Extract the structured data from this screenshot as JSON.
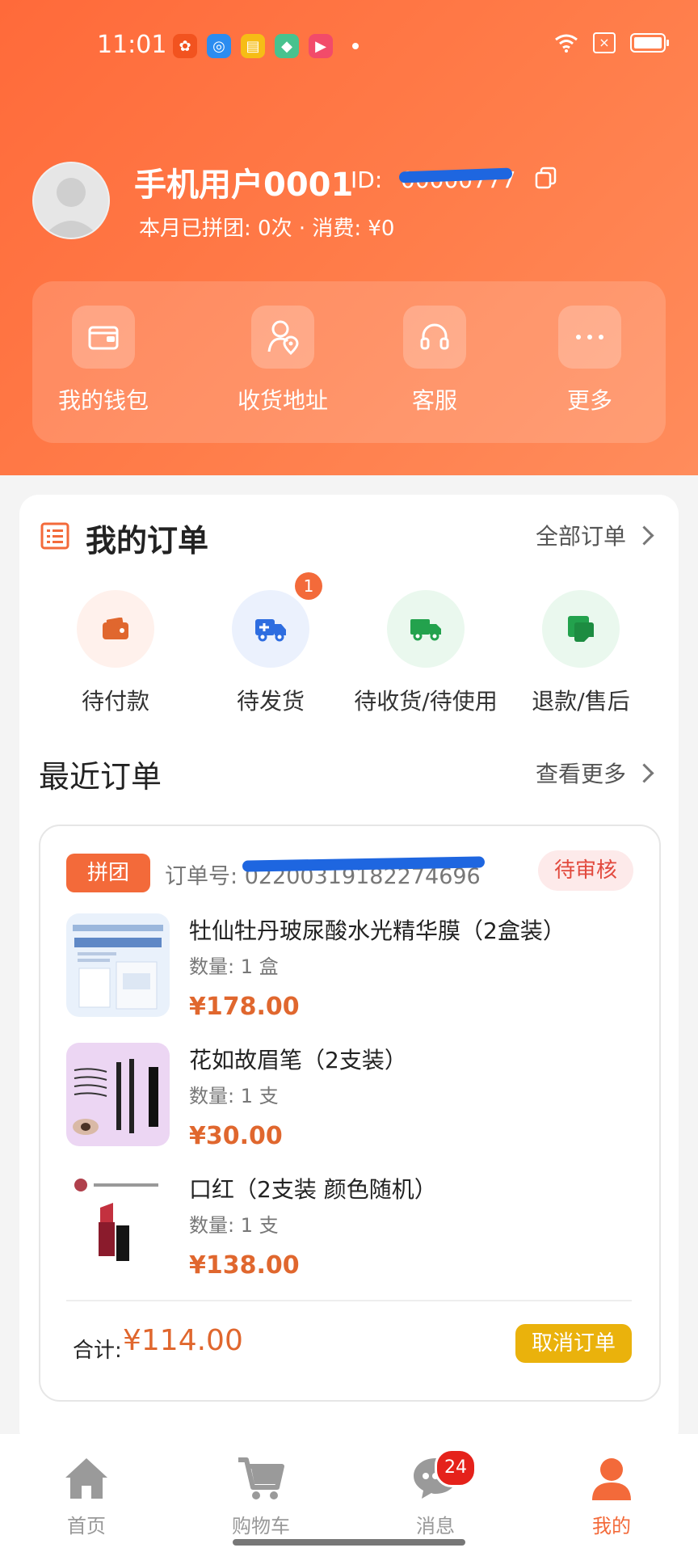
{
  "status_bar": {
    "time": "11:01"
  },
  "profile": {
    "name": "手机用户0001",
    "id_label": "ID:",
    "id_value": "00000777",
    "stats": "本月已拼团: 0次 · 消费: ¥0"
  },
  "quick_actions": [
    {
      "label": "我的钱包",
      "icon": "wallet-icon"
    },
    {
      "label": "收货地址",
      "icon": "location-icon"
    },
    {
      "label": "客服",
      "icon": "headset-icon"
    },
    {
      "label": "更多",
      "icon": "more-icon"
    }
  ],
  "orders": {
    "title": "我的订单",
    "all_orders": "全部订单",
    "statuses": [
      {
        "label": "待付款",
        "icon": "wallet-icon",
        "color": "#e0672e",
        "bg": "#fff1ec"
      },
      {
        "label": "待发货",
        "icon": "delivery-truck-icon",
        "color": "#2e6de0",
        "bg": "#ebf1fd",
        "badge": "1"
      },
      {
        "label": "待收货/待使用",
        "icon": "truck-icon",
        "color": "#23a24d",
        "bg": "#eaf8ee"
      },
      {
        "label": "退款/售后",
        "icon": "refund-icon",
        "color": "#23a24d",
        "bg": "#eaf8ee"
      }
    ]
  },
  "recent": {
    "title": "最近订单",
    "view_more": "查看更多",
    "order": {
      "tag": "拼团",
      "order_no_label": "订单号:",
      "order_no_value": "02200319182274696",
      "status": "待审核",
      "items": [
        {
          "name": "牡仙牡丹玻尿酸水光精华膜（2盒装）",
          "qty": "数量: 1 盒",
          "price": "¥178.00"
        },
        {
          "name": "花如故眉笔（2支装）",
          "qty": "数量: 1 支",
          "price": "¥30.00"
        },
        {
          "name": "口红（2支装 颜色随机）",
          "qty": "数量: 1 支",
          "price": "¥138.00"
        }
      ],
      "total_label": "合计:",
      "total_value": "¥114.00",
      "cancel_label": "取消订单"
    }
  },
  "nav": [
    {
      "label": "首页",
      "icon": "home-icon"
    },
    {
      "label": "购物车",
      "icon": "cart-icon"
    },
    {
      "label": "消息",
      "icon": "message-icon",
      "badge": "24"
    },
    {
      "label": "我的",
      "icon": "profile-icon",
      "active": true
    }
  ],
  "colors": {
    "brand": "#f36a3a",
    "price": "#e0672e",
    "cancel_button": "#eab20c"
  }
}
